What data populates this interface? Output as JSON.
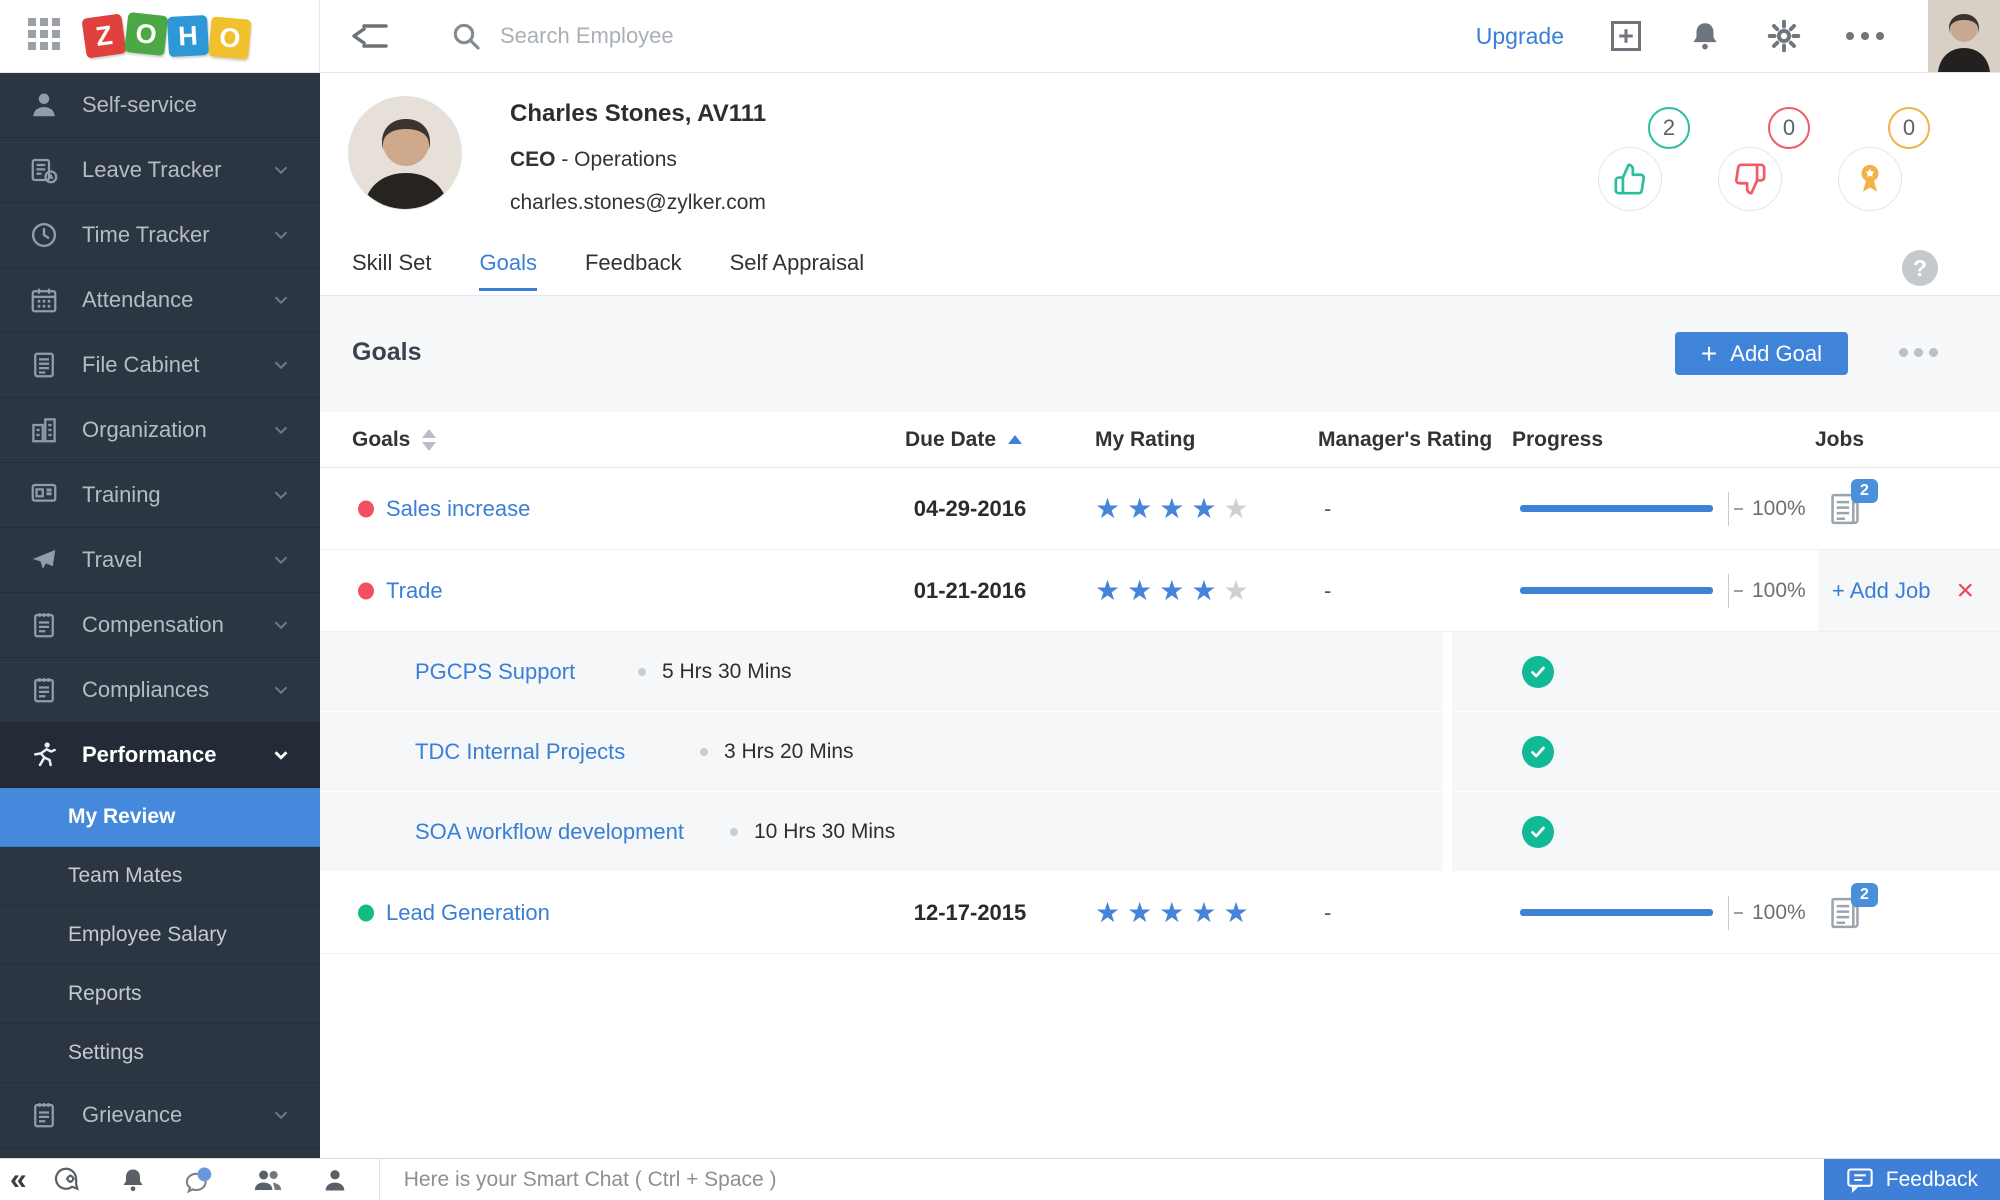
{
  "topbar": {
    "logo_letters": [
      "Z",
      "O",
      "H",
      "O"
    ],
    "search_placeholder": "Search Employee",
    "upgrade_label": "Upgrade"
  },
  "sidebar": {
    "items": [
      {
        "label": "Self-service"
      },
      {
        "label": "Leave Tracker"
      },
      {
        "label": "Time Tracker"
      },
      {
        "label": "Attendance"
      },
      {
        "label": "File Cabinet"
      },
      {
        "label": "Organization"
      },
      {
        "label": "Training"
      },
      {
        "label": "Travel"
      },
      {
        "label": "Compensation"
      },
      {
        "label": "Compliances"
      },
      {
        "label": "Performance"
      },
      {
        "label": "Grievance"
      }
    ],
    "performance_subitems": [
      {
        "label": "My Review"
      },
      {
        "label": "Team Mates"
      },
      {
        "label": "Employee Salary"
      },
      {
        "label": "Reports"
      },
      {
        "label": "Settings"
      }
    ]
  },
  "employee": {
    "name": "Charles Stones, AV111",
    "role_title": "CEO",
    "role_rest": " - Operations",
    "email": "charles.stones@zylker.com",
    "thumbs_up_count": "2",
    "thumbs_down_count": "0",
    "awards_count": "0"
  },
  "tabs": {
    "items": [
      {
        "label": "Skill Set"
      },
      {
        "label": "Goals"
      },
      {
        "label": "Feedback"
      },
      {
        "label": "Self Appraisal"
      }
    ],
    "help_label": "?"
  },
  "goals_section": {
    "title": "Goals",
    "plus": "+",
    "add_goal_label": "Add Goal"
  },
  "table": {
    "headers": {
      "goals": "Goals",
      "due_date": "Due Date",
      "my_rating": "My Rating",
      "managers_rating": "Manager's Rating",
      "progress": "Progress",
      "jobs": "Jobs"
    },
    "rows": [
      {
        "name": "Sales increase",
        "status_color": "#f25060",
        "due": "04-29-2016",
        "rating": 4,
        "manager_rating": "-",
        "progress_label": "100%",
        "jobs_count": "2"
      },
      {
        "name": "Trade",
        "status_color": "#f25060",
        "due": "01-21-2016",
        "rating": 4,
        "manager_rating": "-",
        "progress_label": "100%",
        "add_job_label": "+ Add Job",
        "close_label": "×"
      },
      {
        "name": "Lead Generation",
        "status_color": "#12bd7c",
        "due": "12-17-2015",
        "rating": 5,
        "manager_rating": "-",
        "progress_label": "100%",
        "jobs_count": "2"
      }
    ],
    "jobs": [
      {
        "name": "PGCPS Support",
        "duration": "5 Hrs 30 Mins",
        "done": true
      },
      {
        "name": "TDC Internal Projects",
        "duration": "3 Hrs 20 Mins",
        "done": true
      },
      {
        "name": "SOA workflow development",
        "duration": "10 Hrs 30 Mins",
        "done": true
      }
    ]
  },
  "bottombar": {
    "collapse_glyph": "«",
    "smart_chat_text": "Here is your Smart Chat ( Ctrl + Space )",
    "feedback_label": "Feedback"
  },
  "colors": {
    "accent_blue": "#3a7fd5",
    "badge_teal": "#2bbf9e",
    "badge_red": "#f15b66",
    "badge_yellow": "#f0b24a",
    "check_teal": "#12b996",
    "star_blue": "#4584d9"
  }
}
